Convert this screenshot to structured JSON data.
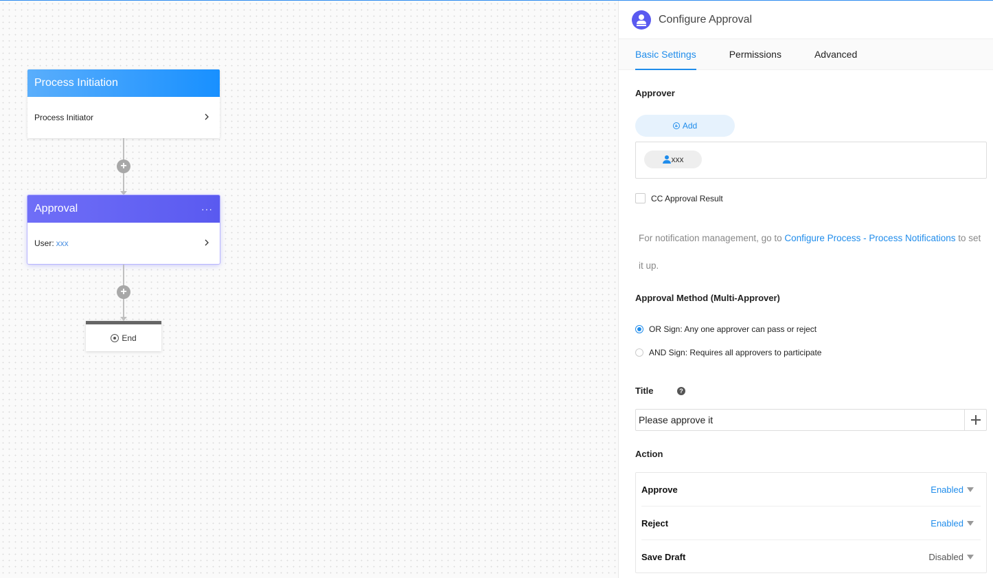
{
  "canvas": {
    "nodes": {
      "initiation": {
        "title": "Process Initiation",
        "body": "Process Initiator"
      },
      "approval": {
        "title": "Approval",
        "more": "···",
        "body_label": "User:",
        "body_value": "xxx"
      },
      "end": {
        "label": "End"
      }
    },
    "add_symbol": "+"
  },
  "panel": {
    "title": "Configure Approval",
    "tabs": [
      {
        "label": "Basic Settings",
        "active": true
      },
      {
        "label": "Permissions",
        "active": false
      },
      {
        "label": "Advanced",
        "active": false
      }
    ],
    "approver": {
      "label": "Approver",
      "add_label": "Add",
      "tags": [
        "xxx"
      ]
    },
    "cc": {
      "label": "CC Approval Result",
      "checked": false
    },
    "notice": {
      "prefix": "For notification management, go to ",
      "link": "Configure Process - Process Notifications",
      "suffix": " to set it up."
    },
    "method": {
      "label": "Approval Method (Multi-Approver)",
      "options": [
        {
          "label": "OR Sign: Any one approver can pass or reject",
          "checked": true
        },
        {
          "label": "AND Sign: Requires all approvers to participate",
          "checked": false
        }
      ]
    },
    "title_field": {
      "label": "Title",
      "help": "?",
      "value": "Please approve it"
    },
    "action": {
      "label": "Action",
      "rows": [
        {
          "name": "Approve",
          "status": "Enabled"
        },
        {
          "name": "Reject",
          "status": "Enabled"
        },
        {
          "name": "Save Draft",
          "status": "Disabled"
        }
      ]
    },
    "colors": {
      "accent": "#1f8ceb",
      "approval_node": "#5a5af0",
      "initiation_node": "#1890ff"
    }
  }
}
